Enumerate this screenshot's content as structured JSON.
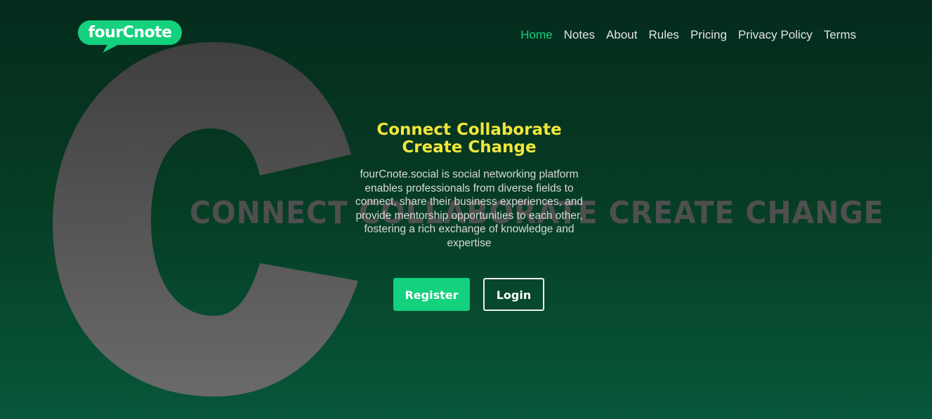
{
  "logo": {
    "text": "fourCnote"
  },
  "nav": {
    "items": [
      {
        "label": "Home",
        "active": true
      },
      {
        "label": "Notes",
        "active": false
      },
      {
        "label": "About",
        "active": false
      },
      {
        "label": "Rules",
        "active": false
      },
      {
        "label": "Pricing",
        "active": false
      },
      {
        "label": "Privacy Policy",
        "active": false
      },
      {
        "label": "Terms",
        "active": false
      }
    ]
  },
  "background": {
    "big_letter": "C",
    "tagline": "CONNECT COLLABORATE CREATE CHANGE"
  },
  "hero": {
    "title_line1": "Connect Collaborate",
    "title_line2": "Create Change",
    "description": "fourCnote.social is social networking platform enables professionals from diverse fields to connect, share their business experiences, and provide mentorship opportunities to each other, fostering a rich exchange of knowledge and expertise"
  },
  "buttons": {
    "register": "Register",
    "login": "Login"
  },
  "colors": {
    "accent": "#14d17e",
    "title": "#f2e63a",
    "background_top": "#042b1c",
    "background_bottom": "#07573a"
  }
}
